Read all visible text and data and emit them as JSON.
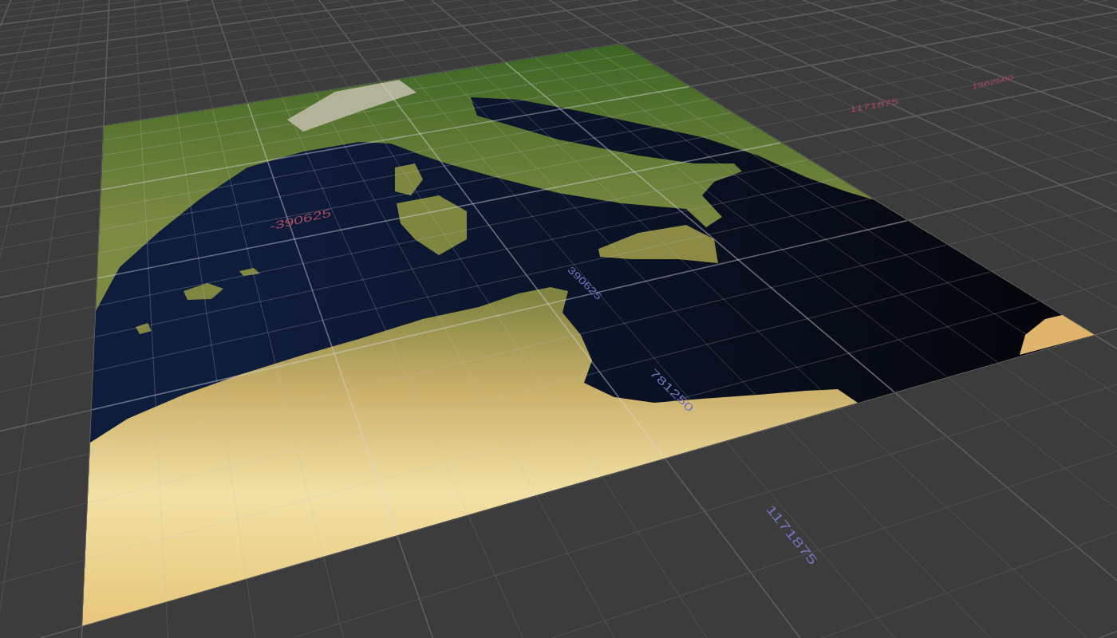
{
  "viewport": {
    "axis_labels": [
      {
        "text": "1562500",
        "color": "#a34a5e"
      },
      {
        "text": "1171875",
        "color": "#a34a5e"
      },
      {
        "text": "-390625",
        "color": "#a34a5e"
      },
      {
        "text": "390625",
        "color": "#7373bc"
      },
      {
        "text": "781250",
        "color": "#7373bc"
      },
      {
        "text": "1171875",
        "color": "#7373bc"
      }
    ]
  }
}
